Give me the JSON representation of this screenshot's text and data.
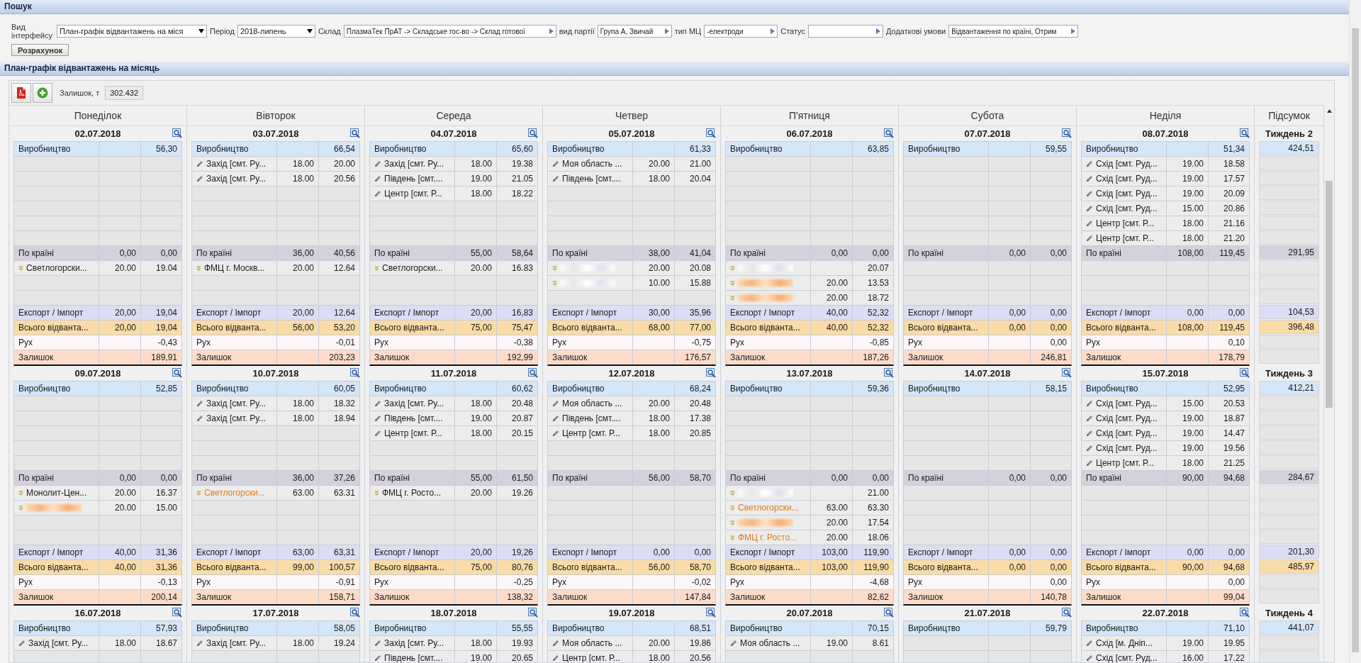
{
  "search_panel": {
    "title": "Пошук",
    "filters": [
      {
        "label": "Вид інтерфейсу",
        "kind": "select",
        "value": "План-графік відвантажень на міся"
      },
      {
        "label": "Період",
        "kind": "select",
        "value": "2018-липень"
      },
      {
        "label": "Склад",
        "kind": "lookup",
        "value": "ПлазмаТек ПрАТ -> Складське гос-во -> Склад готової"
      },
      {
        "label": "вид партії",
        "kind": "lookup",
        "value": "Група А, Звичай"
      },
      {
        "label": "тип МЦ",
        "kind": "lookup",
        "value": "-електроди"
      },
      {
        "label": "Статус",
        "kind": "lookup"
      },
      {
        "label": "Додаткові умови",
        "kind": "lookup",
        "value": "Відвантаження по країні, Отрим"
      }
    ],
    "button": "Розрахунок"
  },
  "schedule": {
    "title": "План-графік відвантажень на місяць",
    "balance_label": "Залишок, т",
    "balance_value": "302.432",
    "weekdays": [
      "Понеділок",
      "Вівторок",
      "Середа",
      "Четвер",
      "П'ятниця",
      "Субота",
      "Неділя"
    ],
    "summary_header": "Підсумок",
    "weeks": [
      {
        "summary": {
          "label": "Тиждень 2",
          "production": "424,51",
          "country": "291,95",
          "export": "104,53",
          "total": "396,48"
        },
        "days": [
          {
            "date": "02.07.2018",
            "production": {
              "label": "Виробництво",
              "fact": "56,30"
            },
            "country": {
              "label": "По країні",
              "plan": "0,00",
              "fact": "0,00"
            },
            "country_items": [
              {
                "name": "Светлогорски...",
                "plan": "20.00",
                "fact": "19.04",
                "highlighted": false,
                "redacted": false
              }
            ],
            "export": {
              "label": "Експорт / Імпорт",
              "plan": "20,00",
              "fact": "19,04"
            },
            "total": {
              "label": "Всього відванта...",
              "plan": "20,00",
              "fact": "19,04"
            },
            "movement": {
              "label": "Рух",
              "fact": "-0,43"
            },
            "balance": {
              "label": "Залишок",
              "fact": "189,91"
            }
          },
          {
            "date": "03.07.2018",
            "production": {
              "label": "Виробництво",
              "fact": "66,54"
            },
            "shipments": [
              {
                "name": "Захід [смт. Ру...",
                "plan": "18.00",
                "fact": "20.00"
              },
              {
                "name": "Захід [смт. Ру...",
                "plan": "18.00",
                "fact": "20.56"
              }
            ],
            "country": {
              "label": "По країні",
              "plan": "36,00",
              "fact": "40,56"
            },
            "country_items": [
              {
                "name": "ФМЦ г. Москв...",
                "plan": "20.00",
                "fact": "12.64",
                "highlighted": false,
                "redacted": false
              }
            ],
            "export": {
              "label": "Експорт / Імпорт",
              "plan": "20,00",
              "fact": "12,64"
            },
            "total": {
              "label": "Всього відванта...",
              "plan": "56,00",
              "fact": "53,20"
            },
            "movement": {
              "label": "Рух",
              "fact": "-0,01"
            },
            "balance": {
              "label": "Залишок",
              "fact": "203,23"
            }
          },
          {
            "date": "04.07.2018",
            "production": {
              "label": "Виробництво",
              "fact": "65,60"
            },
            "shipments": [
              {
                "name": "Захід [смт. Ру...",
                "plan": "18.00",
                "fact": "19.38"
              },
              {
                "name": "Південь [смт....",
                "plan": "19.00",
                "fact": "21.05"
              },
              {
                "name": "Центр [смт. Р...",
                "plan": "18.00",
                "fact": "18.22"
              }
            ],
            "country": {
              "label": "По країні",
              "plan": "55,00",
              "fact": "58,64"
            },
            "country_items": [
              {
                "name": "Светлогорски...",
                "plan": "20.00",
                "fact": "16.83",
                "highlighted": false,
                "redacted": false
              }
            ],
            "export": {
              "label": "Експорт / Імпорт",
              "plan": "20,00",
              "fact": "16,83"
            },
            "total": {
              "label": "Всього відванта...",
              "plan": "75,00",
              "fact": "75,47"
            },
            "movement": {
              "label": "Рух",
              "fact": "-0,38"
            },
            "balance": {
              "label": "Залишок",
              "fact": "192,99"
            }
          },
          {
            "date": "05.07.2018",
            "production": {
              "label": "Виробництво",
              "fact": "61,33"
            },
            "shipments": [
              {
                "name": "Моя область ...",
                "plan": "20.00",
                "fact": "21.00"
              },
              {
                "name": "Південь [смт....",
                "plan": "18.00",
                "fact": "20.04"
              }
            ],
            "country": {
              "label": "По країні",
              "plan": "38,00",
              "fact": "41,04"
            },
            "country_items": [
              {
                "plan": "20.00",
                "fact": "20.08",
                "highlighted": false,
                "redacted": true
              },
              {
                "plan": "10.00",
                "fact": "15.88",
                "highlighted": false,
                "redacted": true
              }
            ],
            "export": {
              "label": "Експорт / Імпорт",
              "plan": "30,00",
              "fact": "35,96"
            },
            "total": {
              "label": "Всього відванта...",
              "plan": "68,00",
              "fact": "77,00"
            },
            "movement": {
              "label": "Рух",
              "fact": "-0,75"
            },
            "balance": {
              "label": "Залишок",
              "fact": "176,57"
            }
          },
          {
            "date": "06.07.2018",
            "production": {
              "label": "Виробництво",
              "fact": "63,85"
            },
            "country": {
              "label": "По країні",
              "plan": "0,00",
              "fact": "0,00"
            },
            "country_items": [
              {
                "fact": "20.07",
                "highlighted": false,
                "redacted": true
              },
              {
                "plan": "20.00",
                "fact": "13.53",
                "highlighted": true,
                "redacted": true
              },
              {
                "plan": "20.00",
                "fact": "18.72",
                "highlighted": true,
                "redacted": true
              }
            ],
            "export": {
              "label": "Експорт / Імпорт",
              "plan": "40,00",
              "fact": "52,32"
            },
            "total": {
              "label": "Всього відванта...",
              "plan": "40,00",
              "fact": "52,32"
            },
            "movement": {
              "label": "Рух",
              "fact": "-0,85"
            },
            "balance": {
              "label": "Залишок",
              "fact": "187,26"
            }
          },
          {
            "date": "07.07.2018",
            "production": {
              "label": "Виробництво",
              "fact": "59,55"
            },
            "country": {
              "label": "По країні",
              "plan": "0,00",
              "fact": "0,00"
            },
            "export": {
              "label": "Експорт / Імпорт",
              "plan": "0,00",
              "fact": "0,00"
            },
            "total": {
              "label": "Всього відванта...",
              "plan": "0,00",
              "fact": "0,00"
            },
            "movement": {
              "label": "Рух",
              "fact": "0,00"
            },
            "balance": {
              "label": "Залишок",
              "fact": "246,81"
            }
          },
          {
            "date": "08.07.2018",
            "production": {
              "label": "Виробництво",
              "fact": "51,34"
            },
            "shipments": [
              {
                "name": "Схід [смт. Руд...",
                "plan": "19.00",
                "fact": "18.58"
              },
              {
                "name": "Схід [смт. Руд...",
                "plan": "19.00",
                "fact": "17.57"
              },
              {
                "name": "Схід [смт. Руд...",
                "plan": "19.00",
                "fact": "20.09"
              },
              {
                "name": "Схід [смт. Руд...",
                "plan": "15.00",
                "fact": "20.86"
              },
              {
                "name": "Центр [смт. Р...",
                "plan": "18.00",
                "fact": "21.16"
              },
              {
                "name": "Центр [смт. Р...",
                "plan": "18.00",
                "fact": "21.20"
              }
            ],
            "country": {
              "label": "По країні",
              "plan": "108,00",
              "fact": "119,45"
            },
            "export": {
              "label": "Експорт / Імпорт",
              "plan": "0,00",
              "fact": "0,00"
            },
            "total": {
              "label": "Всього відванта...",
              "plan": "108,00",
              "fact": "119,45"
            },
            "movement": {
              "label": "Рух",
              "fact": "0,10"
            },
            "balance": {
              "label": "Залишок",
              "fact": "178,79"
            }
          }
        ]
      },
      {
        "summary": {
          "label": "Тиждень 3",
          "production": "412,21",
          "country": "284,67",
          "export": "201,30",
          "total": "485,97"
        },
        "days": [
          {
            "date": "09.07.2018",
            "production": {
              "label": "Виробництво",
              "fact": "52,85"
            },
            "country": {
              "label": "По країні",
              "plan": "0,00",
              "fact": "0,00"
            },
            "country_items": [
              {
                "name": "Монолит-Цен...",
                "plan": "20.00",
                "fact": "16.37",
                "highlighted": false,
                "redacted": false
              },
              {
                "plan": "20.00",
                "fact": "15.00",
                "highlighted": true,
                "redacted": true
              }
            ],
            "export": {
              "label": "Експорт / Імпорт",
              "plan": "40,00",
              "fact": "31,36"
            },
            "total": {
              "label": "Всього відванта...",
              "plan": "40,00",
              "fact": "31,36"
            },
            "movement": {
              "label": "Рух",
              "fact": "-0,13"
            },
            "balance": {
              "label": "Залишок",
              "fact": "200,14"
            }
          },
          {
            "date": "10.07.2018",
            "production": {
              "label": "Виробництво",
              "fact": "60,05"
            },
            "shipments": [
              {
                "name": "Захід [смт. Ру...",
                "plan": "18.00",
                "fact": "18.32"
              },
              {
                "name": "Захід [смт. Ру...",
                "plan": "18.00",
                "fact": "18.94"
              }
            ],
            "country": {
              "label": "По країні",
              "plan": "36,00",
              "fact": "37,26"
            },
            "country_items": [
              {
                "name": "Светлогорски...",
                "plan": "63.00",
                "fact": "63.31",
                "highlighted": true,
                "redacted": false
              }
            ],
            "export": {
              "label": "Експорт / Імпорт",
              "plan": "63,00",
              "fact": "63,31"
            },
            "total": {
              "label": "Всього відванта...",
              "plan": "99,00",
              "fact": "100,57"
            },
            "movement": {
              "label": "Рух",
              "fact": "-0,91"
            },
            "balance": {
              "label": "Залишок",
              "fact": "158,71"
            }
          },
          {
            "date": "11.07.2018",
            "production": {
              "label": "Виробництво",
              "fact": "60,62"
            },
            "shipments": [
              {
                "name": "Захід [смт. Ру...",
                "plan": "18.00",
                "fact": "20.48"
              },
              {
                "name": "Південь [смт....",
                "plan": "19.00",
                "fact": "20.87"
              },
              {
                "name": "Центр [смт. Р...",
                "plan": "18.00",
                "fact": "20.15"
              }
            ],
            "country": {
              "label": "По країні",
              "plan": "55,00",
              "fact": "61,50"
            },
            "country_items": [
              {
                "name": "ФМЦ г. Росто...",
                "plan": "20.00",
                "fact": "19.26",
                "highlighted": false,
                "redacted": false
              }
            ],
            "export": {
              "label": "Експорт / Імпорт",
              "plan": "20,00",
              "fact": "19,26"
            },
            "total": {
              "label": "Всього відванта...",
              "plan": "75,00",
              "fact": "80,76"
            },
            "movement": {
              "label": "Рух",
              "fact": "-0,25"
            },
            "balance": {
              "label": "Залишок",
              "fact": "138,32"
            }
          },
          {
            "date": "12.07.2018",
            "production": {
              "label": "Виробництво",
              "fact": "68,24"
            },
            "shipments": [
              {
                "name": "Моя область ...",
                "plan": "20.00",
                "fact": "20.48"
              },
              {
                "name": "Південь [смт....",
                "plan": "18.00",
                "fact": "17.38"
              },
              {
                "name": "Центр [смт. Р...",
                "plan": "18.00",
                "fact": "20.85"
              }
            ],
            "country": {
              "label": "По країні",
              "plan": "56,00",
              "fact": "58,70"
            },
            "export": {
              "label": "Експорт / Імпорт",
              "plan": "0,00",
              "fact": "0,00"
            },
            "total": {
              "label": "Всього відванта...",
              "plan": "56,00",
              "fact": "58,70"
            },
            "movement": {
              "label": "Рух",
              "fact": "-0,02"
            },
            "balance": {
              "label": "Залишок",
              "fact": "147,84"
            }
          },
          {
            "date": "13.07.2018",
            "production": {
              "label": "Виробництво",
              "fact": "59,36"
            },
            "country": {
              "label": "По країні",
              "plan": "0,00",
              "fact": "0,00"
            },
            "country_items": [
              {
                "fact": "21.00",
                "highlighted": false,
                "redacted": true
              },
              {
                "name": "Светлогорски...",
                "plan": "63.00",
                "fact": "63.30",
                "highlighted": true,
                "redacted": false
              },
              {
                "plan": "20.00",
                "fact": "17.54",
                "highlighted": true,
                "redacted": true
              },
              {
                "name": "ФМЦ г. Росто...",
                "plan": "20.00",
                "fact": "18.06",
                "highlighted": true,
                "redacted": false
              }
            ],
            "export": {
              "label": "Експорт / Імпорт",
              "plan": "103,00",
              "fact": "119,90"
            },
            "total": {
              "label": "Всього відванта...",
              "plan": "103,00",
              "fact": "119,90"
            },
            "movement": {
              "label": "Рух",
              "fact": "-4,68"
            },
            "balance": {
              "label": "Залишок",
              "fact": "82,62"
            }
          },
          {
            "date": "14.07.2018",
            "production": {
              "label": "Виробництво",
              "fact": "58,15"
            },
            "country": {
              "label": "По країні",
              "plan": "0,00",
              "fact": "0,00"
            },
            "export": {
              "label": "Експорт / Імпорт",
              "plan": "0,00",
              "fact": "0,00"
            },
            "total": {
              "label": "Всього відванта...",
              "plan": "0,00",
              "fact": "0,00"
            },
            "movement": {
              "label": "Рух",
              "fact": "0,00"
            },
            "balance": {
              "label": "Залишок",
              "fact": "140,78"
            }
          },
          {
            "date": "15.07.2018",
            "production": {
              "label": "Виробництво",
              "fact": "52,95"
            },
            "shipments": [
              {
                "name": "Схід [смт. Руд...",
                "plan": "15.00",
                "fact": "20.53"
              },
              {
                "name": "Схід [смт. Руд...",
                "plan": "19.00",
                "fact": "18.87"
              },
              {
                "name": "Схід [смт. Руд...",
                "plan": "19.00",
                "fact": "14.47"
              },
              {
                "name": "Схід [смт. Руд...",
                "plan": "19.00",
                "fact": "19.56"
              },
              {
                "name": "Центр [смт. Р...",
                "plan": "18.00",
                "fact": "21.25"
              }
            ],
            "country": {
              "label": "По країні",
              "plan": "90,00",
              "fact": "94,68"
            },
            "export": {
              "label": "Експорт / Імпорт",
              "plan": "0,00",
              "fact": "0,00"
            },
            "total": {
              "label": "Всього відванта...",
              "plan": "90,00",
              "fact": "94,68"
            },
            "movement": {
              "label": "Рух",
              "fact": "0,00"
            },
            "balance": {
              "label": "Залишок",
              "fact": "99,04"
            }
          }
        ]
      },
      {
        "summary": {
          "label": "Тиждень 4",
          "production": "441,07"
        },
        "days": [
          {
            "date": "16.07.2018",
            "production": {
              "label": "Виробництво",
              "fact": "57,93"
            },
            "shipments": [
              {
                "name": "Захід [смт. Ру...",
                "plan": "18.00",
                "fact": "18.67"
              }
            ]
          },
          {
            "date": "17.07.2018",
            "production": {
              "label": "Виробництво",
              "fact": "58,05"
            },
            "shipments": [
              {
                "name": "Захід [смт. Ру...",
                "plan": "18.00",
                "fact": "19.24"
              }
            ]
          },
          {
            "date": "18.07.2018",
            "production": {
              "label": "Виробництво",
              "fact": "55,55"
            },
            "shipments": [
              {
                "name": "Захід [смт. Ру...",
                "plan": "18.00",
                "fact": "19.93"
              },
              {
                "name": "Південь [смт....",
                "plan": "19.00",
                "fact": "20.65"
              }
            ]
          },
          {
            "date": "19.07.2018",
            "production": {
              "label": "Виробництво",
              "fact": "68,51"
            },
            "shipments": [
              {
                "name": "Моя область ...",
                "plan": "20.00",
                "fact": "19.86"
              },
              {
                "name": "Центр [смт. Р...",
                "plan": "18.00",
                "fact": "20.56"
              }
            ]
          },
          {
            "date": "20.07.2018",
            "production": {
              "label": "Виробництво",
              "fact": "70,15"
            },
            "shipments": [
              {
                "name": "Моя область ...",
                "plan": "19.00",
                "fact": "8.61"
              }
            ]
          },
          {
            "date": "21.07.2018",
            "production": {
              "label": "Виробництво",
              "fact": "59,79"
            }
          },
          {
            "date": "22.07.2018",
            "production": {
              "label": "Виробництво",
              "fact": "71,10"
            },
            "shipments": [
              {
                "name": "Схід [м. Дніп...",
                "plan": "19.00",
                "fact": "19.95"
              },
              {
                "name": "Схід [смт. Руд...",
                "plan": "16.00",
                "fact": "17.22"
              }
            ]
          }
        ]
      }
    ]
  }
}
